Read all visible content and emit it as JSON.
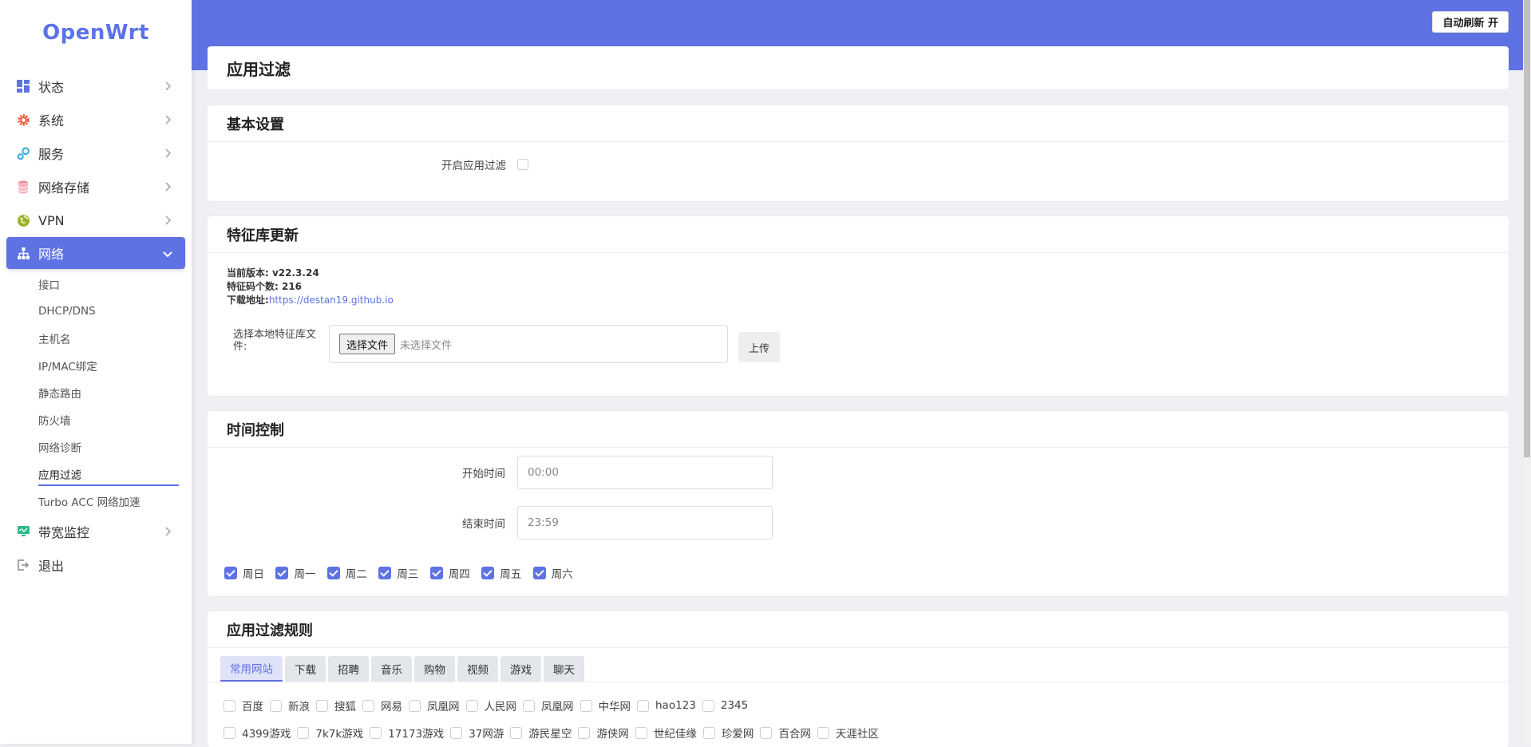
{
  "brand": "OpenWrt",
  "nav": [
    {
      "key": "status",
      "label": "状态",
      "icon": "dashboard-icon"
    },
    {
      "key": "system",
      "label": "系统",
      "icon": "gear-icon"
    },
    {
      "key": "services",
      "label": "服务",
      "icon": "services-icon"
    },
    {
      "key": "storage",
      "label": "网络存储",
      "icon": "database-icon"
    },
    {
      "key": "vpn",
      "label": "VPN",
      "icon": "globe-icon"
    },
    {
      "key": "network",
      "label": "网络",
      "icon": "network-icon"
    },
    {
      "key": "bandwidth",
      "label": "带宽监控",
      "icon": "monitor-icon"
    },
    {
      "key": "logout",
      "label": "退出",
      "icon": "logout-icon"
    }
  ],
  "network_sub": [
    "接口",
    "DHCP/DNS",
    "主机名",
    "IP/MAC绑定",
    "静态路由",
    "防火墙",
    "网络诊断",
    "应用过滤",
    "Turbo ACC 网络加速"
  ],
  "header": {
    "refresh_button": "自动刷新 开"
  },
  "page": {
    "title": "应用过滤"
  },
  "basic": {
    "title": "基本设置",
    "enable_label": "开启应用过滤"
  },
  "feature": {
    "title": "特征库更新",
    "version": "当前版本: v22.3.24",
    "count": "特征码个数: 216",
    "download_prefix": "下载地址:",
    "download_url": "https://destan19.github.io",
    "file_label": "选择本地特征库文件:",
    "file_button": "选择文件",
    "file_hint": "未选择文件",
    "upload_button": "上传"
  },
  "time": {
    "title": "时间控制",
    "start_label": "开始时间",
    "start_value": "00:00",
    "end_label": "结束时间",
    "end_value": "23:59",
    "days": [
      "周日",
      "周一",
      "周二",
      "周三",
      "周四",
      "周五",
      "周六"
    ]
  },
  "rules": {
    "title": "应用过滤规则",
    "tabs": [
      "常用网站",
      "下载",
      "招聘",
      "音乐",
      "购物",
      "视频",
      "游戏",
      "聊天"
    ],
    "row1": [
      "百度",
      "新浪",
      "搜狐",
      "网易",
      "凤凰网",
      "人民网",
      "凤凰网",
      "中华网",
      "hao123",
      "2345"
    ],
    "row2": [
      "4399游戏",
      "7k7k游戏",
      "17173游戏",
      "37网游",
      "游民星空",
      "游侠网",
      "世纪佳缘",
      "珍爱网",
      "百合网",
      "天涯社区"
    ]
  }
}
